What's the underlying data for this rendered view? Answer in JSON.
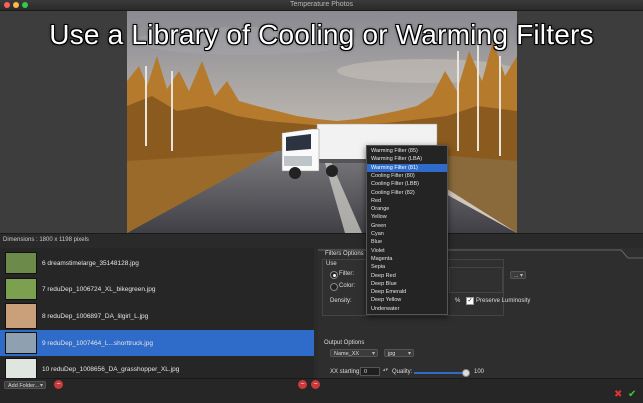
{
  "window": {
    "title": "Temperature Photos"
  },
  "preview": {
    "headline": "Use a Library of Cooling or Warming Filters",
    "dimensions": "Dimensions : 1800 x 1198 pixels"
  },
  "files": [
    {
      "label": "6 dreamstimelarge_35148128.jpg",
      "selected": false,
      "thumb_color": "#6c8a4a"
    },
    {
      "label": "7 reduDep_1006724_XL_bikegreen.jpg",
      "selected": false,
      "thumb_color": "#7aa050"
    },
    {
      "label": "8 reduDep_1006897_DA_lilgirl_L.jpg",
      "selected": false,
      "thumb_color": "#c9a07a"
    },
    {
      "label": "9 reduDep_1007464_L...shorttruck.jpg",
      "selected": true,
      "thumb_color": "#8fa0b0"
    },
    {
      "label": "10 reduDep_1008656_DA_grasshopper_XL.jpg",
      "selected": false,
      "thumb_color": "#dfe6e0"
    }
  ],
  "bottom": {
    "add_folder": "Add Folder...",
    "remove_icon": "−",
    "ok_icon": "✔",
    "cancel_icon": "✖"
  },
  "filters_options": {
    "title": "Filters Options",
    "use_label": "Use",
    "filter_label": "Filter:",
    "color_label": "Color:",
    "density_label": "Density:",
    "percent": "%",
    "preserve_luminosity": "Preserve Luminosity",
    "color_popup": "..."
  },
  "output_options": {
    "title": "Output Options",
    "name_popup": "Name_XX",
    "format_popup": "jpg",
    "xx_starting_label": "XX starting:",
    "xx_starting_value": "0",
    "quality_label": "Quality:",
    "quality_value": "100",
    "quality_level": 1.0
  },
  "menu": {
    "items": [
      "Warming Filter (85)",
      "Warming Filter (LBA)",
      "Warming Filter (81)",
      "Cooling Filter (80)",
      "Cooling Filter (LBB)",
      "Cooling Filter (82)",
      "Red",
      "Orange",
      "Yellow",
      "Green",
      "Cyan",
      "Blue",
      "Violet",
      "Magenta",
      "Sepia",
      "Deep Red",
      "Deep Blue",
      "Deep Emerald",
      "Deep Yellow",
      "Underwater"
    ],
    "highlighted_index": 2
  },
  "colors": {
    "selection": "#2f6bc9",
    "window_bg": "#2b2b2b"
  }
}
